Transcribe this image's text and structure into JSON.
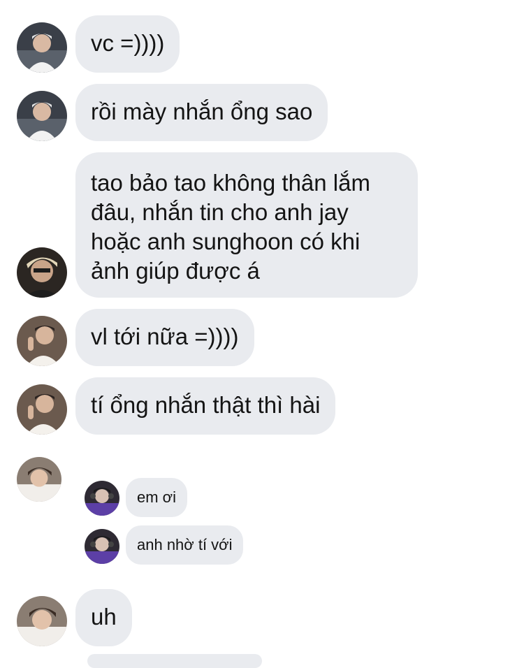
{
  "messages": [
    {
      "text": "vc =))))"
    },
    {
      "text": "rồi mày nhắn ổng sao"
    },
    {
      "text": "tao bảo tao không thân lắm đâu, nhắn tin cho anh jay hoặc anh sunghoon có khi ảnh giúp được á"
    },
    {
      "text": "vl tới nữa =))))"
    },
    {
      "text": "tí ổng nhắn thật thì hài"
    },
    {
      "text": "uh"
    }
  ],
  "forwarded": [
    {
      "text": "em ơi"
    },
    {
      "text": "anh nhờ tí với"
    }
  ],
  "colors": {
    "bubble": "#e9ebef",
    "text": "#141414",
    "background": "#ffffff"
  }
}
